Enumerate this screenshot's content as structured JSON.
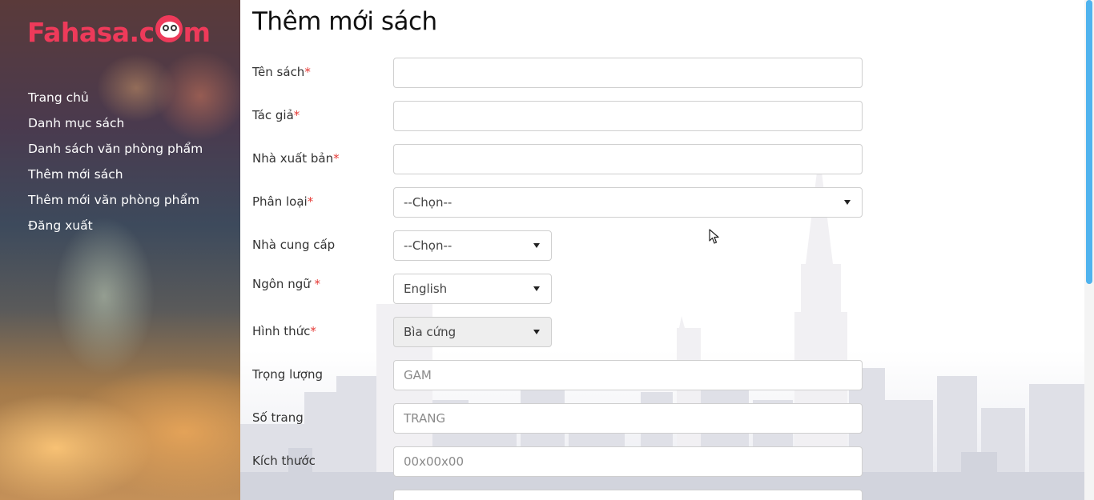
{
  "sidebar": {
    "logo": {
      "text_before": "Fahasa.c",
      "text_after": "m"
    },
    "nav": [
      {
        "label": "Trang chủ"
      },
      {
        "label": "Danh mục sách"
      },
      {
        "label": "Danh sách văn phòng phẩm"
      },
      {
        "label": "Thêm mới sách"
      },
      {
        "label": "Thêm mới văn phòng phẩm"
      },
      {
        "label": "Đăng xuất"
      }
    ]
  },
  "main": {
    "title": "Thêm mới sách",
    "required_mark": "*",
    "fields": {
      "ten_sach": {
        "label": "Tên sách",
        "value": ""
      },
      "tac_gia": {
        "label": "Tác giả",
        "value": ""
      },
      "nha_xuat_ban": {
        "label": "Nhà xuất bản",
        "value": ""
      },
      "phan_loai": {
        "label": "Phân loại",
        "selected": "--Chọn--"
      },
      "nha_cung_cap": {
        "label": "Nhà cung cấp",
        "selected": "--Chọn--"
      },
      "ngon_ngu": {
        "label": "Ngôn ngữ",
        "selected": "English"
      },
      "hinh_thuc": {
        "label": "Hình thức",
        "selected": "Bìa cứng"
      },
      "trong_luong": {
        "label": "Trọng lượng",
        "placeholder": "GAM"
      },
      "so_trang": {
        "label": "Số trang",
        "placeholder": "TRANG"
      },
      "kich_thuoc": {
        "label": "Kích thước",
        "placeholder": "00x00x00"
      }
    }
  },
  "colors": {
    "brand": "#ee3a5a",
    "required": "#e53935",
    "scrollbar": "#4fb3ee"
  },
  "icons": {
    "select_caret": "caret-down-icon",
    "cursor": "mouse-cursor-icon",
    "mascot": "owl-mascot-icon"
  }
}
